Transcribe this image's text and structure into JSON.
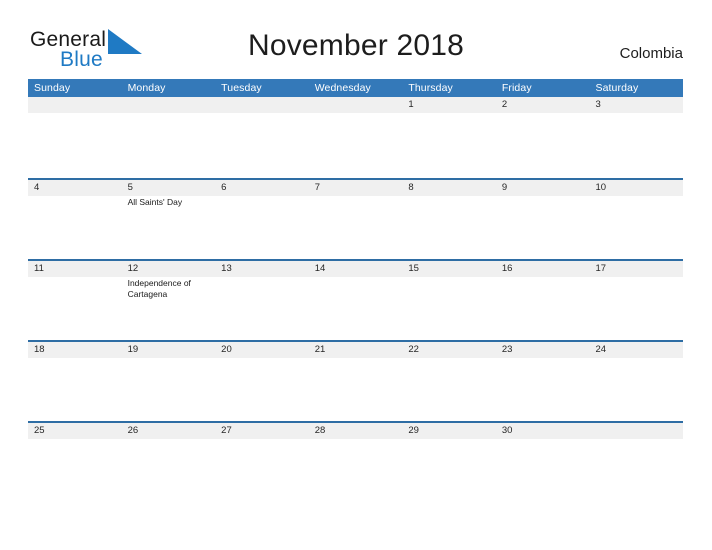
{
  "brand": {
    "name_part1": "General",
    "name_part2": "Blue",
    "flag_icon": "flag-triangle-icon",
    "accent_color": "#1f7ac4"
  },
  "header": {
    "title": "November 2018",
    "country": "Colombia"
  },
  "theme": {
    "header_blue": "#3479b9",
    "row_rule_blue": "#2e6da4",
    "band_gray": "#f0f0f0",
    "text_dark": "#1d1d1d"
  },
  "calendar": {
    "month": "November",
    "year": "2018",
    "weekdays": [
      "Sunday",
      "Monday",
      "Tuesday",
      "Wednesday",
      "Thursday",
      "Friday",
      "Saturday"
    ],
    "weeks": [
      [
        {
          "num": "",
          "events": []
        },
        {
          "num": "",
          "events": []
        },
        {
          "num": "",
          "events": []
        },
        {
          "num": "",
          "events": []
        },
        {
          "num": "1",
          "events": []
        },
        {
          "num": "2",
          "events": []
        },
        {
          "num": "3",
          "events": []
        }
      ],
      [
        {
          "num": "4",
          "events": []
        },
        {
          "num": "5",
          "events": [
            "All Saints' Day"
          ]
        },
        {
          "num": "6",
          "events": []
        },
        {
          "num": "7",
          "events": []
        },
        {
          "num": "8",
          "events": []
        },
        {
          "num": "9",
          "events": []
        },
        {
          "num": "10",
          "events": []
        }
      ],
      [
        {
          "num": "11",
          "events": []
        },
        {
          "num": "12",
          "events": [
            "Independence of Cartagena"
          ]
        },
        {
          "num": "13",
          "events": []
        },
        {
          "num": "14",
          "events": []
        },
        {
          "num": "15",
          "events": []
        },
        {
          "num": "16",
          "events": []
        },
        {
          "num": "17",
          "events": []
        }
      ],
      [
        {
          "num": "18",
          "events": []
        },
        {
          "num": "19",
          "events": []
        },
        {
          "num": "20",
          "events": []
        },
        {
          "num": "21",
          "events": []
        },
        {
          "num": "22",
          "events": []
        },
        {
          "num": "23",
          "events": []
        },
        {
          "num": "24",
          "events": []
        }
      ],
      [
        {
          "num": "25",
          "events": []
        },
        {
          "num": "26",
          "events": []
        },
        {
          "num": "27",
          "events": []
        },
        {
          "num": "28",
          "events": []
        },
        {
          "num": "29",
          "events": []
        },
        {
          "num": "30",
          "events": []
        },
        {
          "num": "",
          "events": []
        }
      ]
    ]
  }
}
